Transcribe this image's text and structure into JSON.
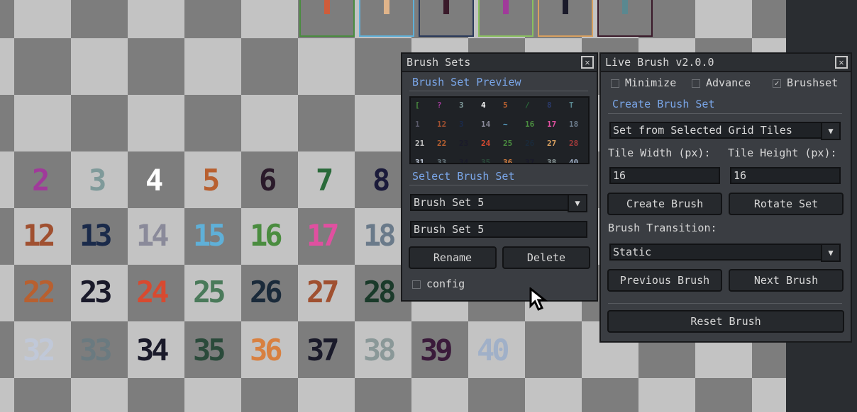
{
  "canvas": {
    "top_tile_colors": [
      {
        "bar": "#cf5c3a",
        "border": "#4a8c3f"
      },
      {
        "bar": "#e0b48a",
        "border": "#5fb0d8"
      },
      {
        "bar": "#3a1a2a",
        "border": "#2a3a5a"
      },
      {
        "bar": "#a03a9a",
        "border": "#8ac060"
      },
      {
        "bar": "#1a1a2a",
        "border": "#d8a060"
      },
      {
        "bar": "#5a8890",
        "border": "#3a1a2a"
      }
    ],
    "glyphs": [
      {
        "text": "2",
        "color": "#a03a9a"
      },
      {
        "text": "3",
        "color": "#7f9a9a"
      },
      {
        "text": "4",
        "color": "#ffffff"
      },
      {
        "text": "5",
        "color": "#b86030"
      },
      {
        "text": "6",
        "color": "#2a1a2a"
      },
      {
        "text": "7",
        "color": "#2a6a3a"
      },
      {
        "text": "8",
        "color": "#1a1a3a"
      },
      {
        "text": "12",
        "color": "#a05030"
      },
      {
        "text": "13",
        "color": "#1a2a4a"
      },
      {
        "text": "14",
        "color": "#8a8a9a"
      },
      {
        "text": "15",
        "color": "#5fb0d8"
      },
      {
        "text": "16",
        "color": "#4a8c3f"
      },
      {
        "text": "17",
        "color": "#e050a0"
      },
      {
        "text": "18",
        "color": "#6a7a8a"
      },
      {
        "text": "22",
        "color": "#b86030"
      },
      {
        "text": "23",
        "color": "#1a1a2a"
      },
      {
        "text": "24",
        "color": "#d84a30"
      },
      {
        "text": "25",
        "color": "#4a7a5a"
      },
      {
        "text": "26",
        "color": "#1a2a3a"
      },
      {
        "text": "27",
        "color": "#a05030"
      },
      {
        "text": "28",
        "color": "#1a3a2a"
      },
      {
        "text": "32",
        "color": "#c0c8d8"
      },
      {
        "text": "33",
        "color": "#6a7a80"
      },
      {
        "text": "34",
        "color": "#1a1a2a"
      },
      {
        "text": "35",
        "color": "#2a4a3a"
      },
      {
        "text": "36",
        "color": "#d88040"
      },
      {
        "text": "37",
        "color": "#1a1a2a"
      },
      {
        "text": "38",
        "color": "#8a9898"
      },
      {
        "text": "39",
        "color": "#3a1a3a"
      },
      {
        "text": "40",
        "color": "#a0b0c8"
      }
    ]
  },
  "brush_sets_panel": {
    "title": "Brush Sets",
    "preview_heading": "Brush Set Preview",
    "select_heading": "Select Brush Set",
    "selected_set": "Brush Set 5",
    "name_value": "Brush Set 5",
    "rename_label": "Rename",
    "delete_label": "Delete",
    "config_label": "config",
    "preview_glyphs": [
      {
        "t": "[",
        "c": "#4a8c3f"
      },
      {
        "t": "?",
        "c": "#a03a9a"
      },
      {
        "t": "3",
        "c": "#7f9a9a"
      },
      {
        "t": "4",
        "c": "#ffffff"
      },
      {
        "t": "5",
        "c": "#b86030"
      },
      {
        "t": "/",
        "c": "#2a6a3a"
      },
      {
        "t": "8",
        "c": "#2a3a6a"
      },
      {
        "t": "T",
        "c": "#5a8890"
      },
      {
        "t": "1",
        "c": "#5a5a6a"
      },
      {
        "t": "12",
        "c": "#a05030"
      },
      {
        "t": "3",
        "c": "#1a2a4a"
      },
      {
        "t": "14",
        "c": "#8a8a9a"
      },
      {
        "t": "~",
        "c": "#5fb0d8"
      },
      {
        "t": "16",
        "c": "#4a8c3f"
      },
      {
        "t": "17",
        "c": "#e050a0"
      },
      {
        "t": "18",
        "c": "#6a7a8a"
      },
      {
        "t": "21",
        "c": "#c0c0c0"
      },
      {
        "t": "22",
        "c": "#b86030"
      },
      {
        "t": "23",
        "c": "#1a1a2a"
      },
      {
        "t": "24",
        "c": "#d84a30"
      },
      {
        "t": "25",
        "c": "#4a8c3f"
      },
      {
        "t": "26",
        "c": "#1a2a3a"
      },
      {
        "t": "27",
        "c": "#d8a060"
      },
      {
        "t": "28",
        "c": "#a03a3a"
      },
      {
        "t": "31",
        "c": "#c0c8d8"
      },
      {
        "t": "33",
        "c": "#6a7a80"
      },
      {
        "t": "34",
        "c": "#1a1a2a"
      },
      {
        "t": "35",
        "c": "#2a4a3a"
      },
      {
        "t": "36",
        "c": "#d88040"
      },
      {
        "t": "37",
        "c": "#1a1a2a"
      },
      {
        "t": "38",
        "c": "#8a9898"
      },
      {
        "t": "40",
        "c": "#a0b0c8"
      }
    ]
  },
  "live_brush_panel": {
    "title": "Live Brush v2.0.0",
    "minimize_label": "Minimize",
    "advance_label": "Advance",
    "brushset_label": "Brushset",
    "brushset_checked": true,
    "create_heading": "Create Brush Set",
    "source_option": "Set from Selected Grid Tiles",
    "tile_width_label": "Tile Width (px):",
    "tile_height_label": "Tile Height (px):",
    "tile_width_value": "16",
    "tile_height_value": "16",
    "create_brush_label": "Create Brush",
    "rotate_set_label": "Rotate Set",
    "transition_label": "Brush Transition:",
    "transition_value": "Static",
    "previous_label": "Previous Brush",
    "next_label": "Next Brush",
    "reset_label": "Reset Brush"
  },
  "icons": {
    "close": "close-icon",
    "dropdown": "chevron-down-icon",
    "checkmark": "checkmark-icon",
    "cursor": "mouse-cursor-icon"
  }
}
